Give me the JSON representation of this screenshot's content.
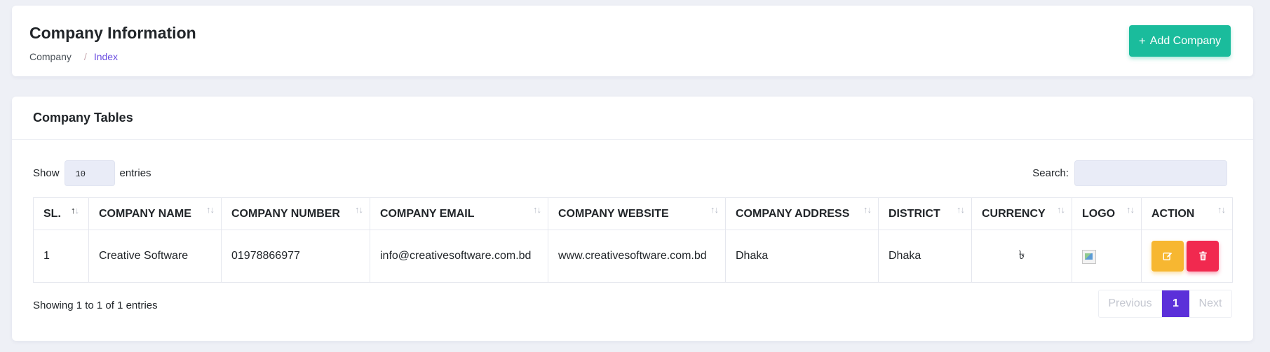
{
  "header": {
    "title": "Company Information",
    "breadcrumb": {
      "home": "Company",
      "separator": "/",
      "current": "Index"
    },
    "add_button": {
      "icon": "plus-icon",
      "label": "Add Company"
    }
  },
  "table_card": {
    "title": "Company Tables",
    "length": {
      "prefix": "Show",
      "value": "10",
      "suffix": "entries"
    },
    "search": {
      "label": "Search:",
      "value": ""
    },
    "columns": [
      "SL.",
      "COMPANY NAME",
      "COMPANY NUMBER",
      "COMPANY EMAIL",
      "COMPANY WEBSITE",
      "COMPANY ADDRESS",
      "DISTRICT",
      "CURRENCY",
      "LOGO",
      "ACTION"
    ],
    "sorted_column": "SL.",
    "rows": [
      {
        "sl": "1",
        "name": "Creative Software",
        "number": "01978866977",
        "email": "info@creativesoftware.com.bd",
        "website": "www.creativesoftware.com.bd",
        "address": "Dhaka",
        "district": "Dhaka",
        "currency": "৳",
        "logo": "broken-image-icon",
        "actions": [
          "edit-icon",
          "trash-icon"
        ]
      }
    ],
    "info": "Showing 1 to 1 of 1 entries",
    "pagination": {
      "previous": "Previous",
      "current": "1",
      "next": "Next"
    }
  },
  "colors": {
    "accent_green": "#1abc9c",
    "primary_purple": "#5b30d9",
    "edit_yellow": "#f7b731",
    "delete_red": "#f1294f",
    "background": "#eef0f6"
  }
}
